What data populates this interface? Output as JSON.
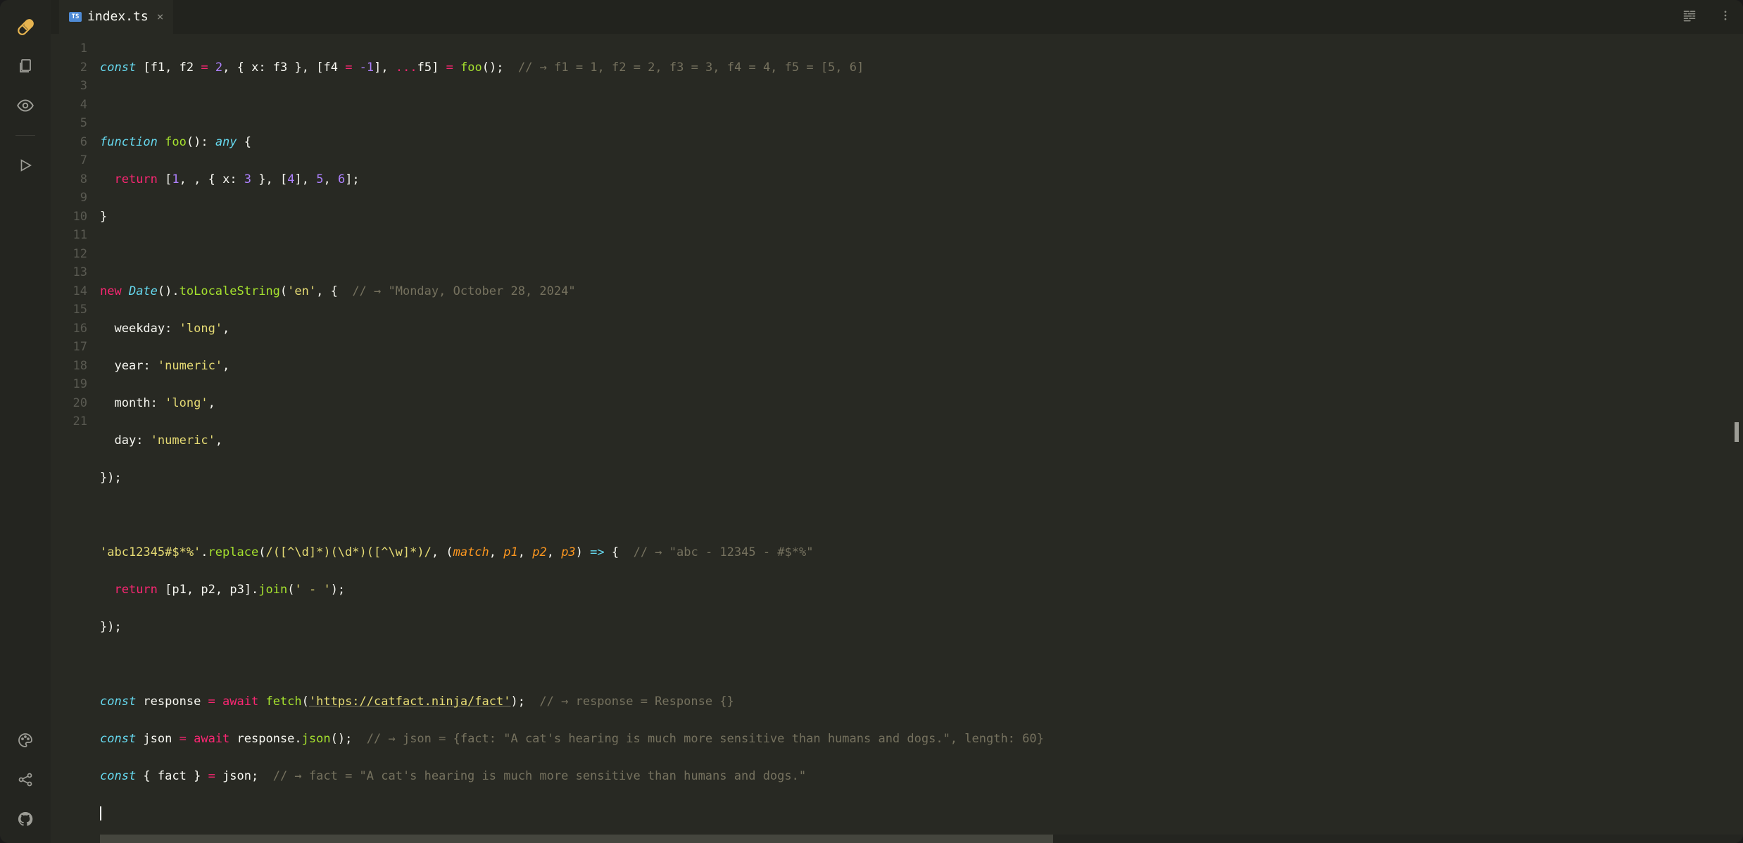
{
  "tab": {
    "filename": "index.ts",
    "icon_label": "TS"
  },
  "line_numbers": [
    "1",
    "2",
    "3",
    "4",
    "5",
    "6",
    "7",
    "8",
    "9",
    "10",
    "11",
    "12",
    "13",
    "14",
    "15",
    "16",
    "17",
    "18",
    "19",
    "20",
    "21"
  ],
  "code": {
    "l1": {
      "const": "const",
      "sp": " ",
      "ob": "[",
      "f1": "f1",
      "c1": ", ",
      "f2": "f2",
      "eq": " = ",
      "n2": "2",
      "c2": ", { ",
      "x": "x",
      "col": ": ",
      "f3": "f3",
      "cb": " }, [",
      "f4": "f4",
      "eq2": " = ",
      "neg1": "-1",
      "cb2": "], ",
      "spread": "...",
      "f5": "f5",
      "end": "] ",
      "eq3": "= ",
      "foo": "foo",
      "call": "();  ",
      "cmt": "// → f1 = 1, f2 = 2, f3 = 3, f4 = 4, f5 = [5, 6]"
    },
    "l3": {
      "fn": "function ",
      "name": "foo",
      "paren": "()",
      "col": ": ",
      "any": "any ",
      "brace": "{"
    },
    "l4": {
      "ind": "  ",
      "ret": "return ",
      "ob": "[",
      "n1": "1",
      "c1": ", , { ",
      "x": "x",
      "col": ": ",
      "n3": "3",
      "c2": " }, [",
      "n4": "4",
      "c3": "], ",
      "n5": "5",
      "c4": ", ",
      "n6": "6",
      "end": "];"
    },
    "l5": {
      "brace": "}"
    },
    "l7": {
      "new": "new ",
      "date": "Date",
      "p1": "().",
      "tls": "toLocaleString",
      "p2": "(",
      "s": "'en'",
      "c": ", {  ",
      "cmt": "// → \"Monday, October 28, 2024\""
    },
    "l8": {
      "ind": "  ",
      "k": "weekday",
      "col": ": ",
      "v": "'long'",
      "c": ","
    },
    "l9": {
      "ind": "  ",
      "k": "year",
      "col": ": ",
      "v": "'numeric'",
      "c": ","
    },
    "l10": {
      "ind": "  ",
      "k": "month",
      "col": ": ",
      "v": "'long'",
      "c": ","
    },
    "l11": {
      "ind": "  ",
      "k": "day",
      "col": ": ",
      "v": "'numeric'",
      "c": ","
    },
    "l12": {
      "end": "});"
    },
    "l14": {
      "s": "'abc12345#$*%'",
      "dot": ".",
      "rep": "replace",
      "p1": "(",
      "rex": "/([^\\d]*)(\\d*)([^\\w]*)/",
      "c": ", (",
      "m": "match",
      "c1": ", ",
      "p1n": "p1",
      "c2": ", ",
      "p2n": "p2",
      "c3": ", ",
      "p3n": "p3",
      "arr": ") ",
      "fat": "=>",
      "ob": " {  ",
      "cmt": "// → \"abc - 12345 - #$*%\""
    },
    "l15": {
      "ind": "  ",
      "ret": "return ",
      "ob": "[",
      "p1": "p1",
      "c1": ", ",
      "p2": "p2",
      "c2": ", ",
      "p3": "p3",
      "cb": "].",
      "join": "join",
      "p": "(",
      "s": "' - '",
      "end": ");"
    },
    "l16": {
      "end": "});"
    },
    "l18": {
      "const": "const ",
      "v": "response ",
      "eq": "= ",
      "aw": "await ",
      "fn": "fetch",
      "p": "(",
      "url": "'https://catfact.ninja/fact'",
      "end": ");  ",
      "cmt": "// → response = Response {}"
    },
    "l19": {
      "const": "const ",
      "v": "json ",
      "eq": "= ",
      "aw": "await ",
      "r": "response.",
      "fn": "json",
      "end": "();  ",
      "cmt": "// → json = {fact: \"A cat's hearing is much more sensitive than humans and dogs.\", length: 60}"
    },
    "l20": {
      "const": "const ",
      "ob": "{ ",
      "v": "fact ",
      "cb": "} ",
      "eq": "= ",
      "j": "json;  ",
      "cmt": "// → fact = \"A cat's hearing is much more sensitive than humans and dogs.\""
    }
  }
}
